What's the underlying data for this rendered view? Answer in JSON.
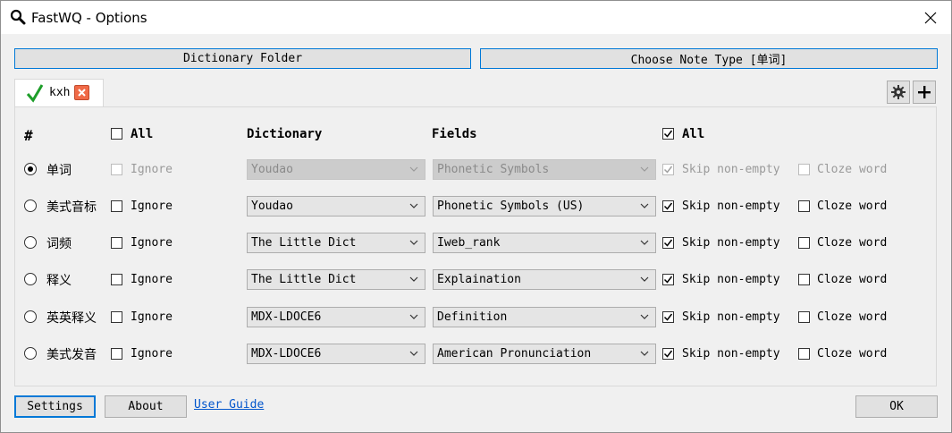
{
  "window": {
    "title": "FastWQ - Options"
  },
  "toolbar": {
    "dictionary_folder": "Dictionary Folder",
    "choose_note_type": "Choose Note Type [单词]"
  },
  "tabs": [
    {
      "label": "kxh",
      "active": true
    }
  ],
  "headers": {
    "hash": "#",
    "ignore_all": "All",
    "dictionary": "Dictionary",
    "fields": "Fields",
    "skip_all": "All"
  },
  "rows": [
    {
      "field": "单词",
      "selected": true,
      "ignore": "Ignore",
      "dictionary": "Youdao",
      "dict_field": "Phonetic Symbols",
      "skip": "Skip non-empty",
      "skip_checked": true,
      "cloze": "Cloze word",
      "disabled": true
    },
    {
      "field": "美式音标",
      "selected": false,
      "ignore": "Ignore",
      "dictionary": "Youdao",
      "dict_field": "Phonetic Symbols (US)",
      "skip": "Skip non-empty",
      "skip_checked": true,
      "cloze": "Cloze word",
      "disabled": false
    },
    {
      "field": "词频",
      "selected": false,
      "ignore": "Ignore",
      "dictionary": "The Little Dict",
      "dict_field": "Iweb_rank",
      "skip": "Skip non-empty",
      "skip_checked": true,
      "cloze": "Cloze word",
      "disabled": false
    },
    {
      "field": "释义",
      "selected": false,
      "ignore": "Ignore",
      "dictionary": "The Little Dict",
      "dict_field": "Explaination",
      "skip": "Skip non-empty",
      "skip_checked": true,
      "cloze": "Cloze word",
      "disabled": false
    },
    {
      "field": "英英释义",
      "selected": false,
      "ignore": "Ignore",
      "dictionary": "MDX-LDOCE6",
      "dict_field": "Definition",
      "skip": "Skip non-empty",
      "skip_checked": true,
      "cloze": "Cloze word",
      "disabled": false
    },
    {
      "field": "美式发音",
      "selected": false,
      "ignore": "Ignore",
      "dictionary": "MDX-LDOCE6",
      "dict_field": "American Pronunciation",
      "skip": "Skip non-empty",
      "skip_checked": true,
      "cloze": "Cloze word",
      "disabled": false
    }
  ],
  "footer": {
    "settings": "Settings",
    "about": "About",
    "user_guide": "User Guide",
    "ok": "OK"
  },
  "colors": {
    "accent": "#0078d7",
    "check_green": "#1e9e2a",
    "tab_close": "#f06a47",
    "link": "#0055cc"
  }
}
